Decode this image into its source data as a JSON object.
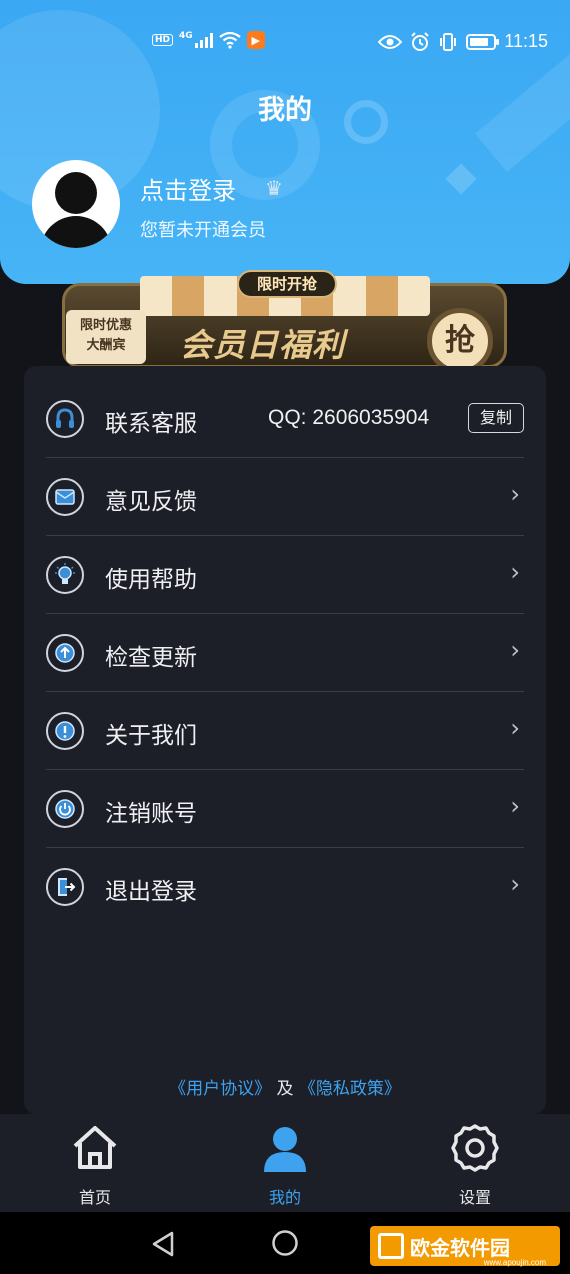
{
  "statusbar": {
    "network_badge": "HD",
    "network_type": "4G",
    "time": "11:15"
  },
  "header": {
    "title": "我的",
    "login_prompt": "点击登录",
    "vip_status": "您暂未开通会员"
  },
  "banner": {
    "tag": "限时开抢",
    "promo_line1": "限时优惠",
    "promo_line2": "大酬宾",
    "headline": "会员日福利",
    "grab_label": "抢"
  },
  "menu": {
    "items": [
      {
        "label": "联系客服",
        "icon": "headset-icon"
      },
      {
        "label": "意见反馈",
        "icon": "feedback-mail-icon"
      },
      {
        "label": "使用帮助",
        "icon": "lightbulb-icon"
      },
      {
        "label": "检查更新",
        "icon": "upload-arrow-icon"
      },
      {
        "label": "关于我们",
        "icon": "info-icon"
      },
      {
        "label": "注销账号",
        "icon": "power-icon"
      },
      {
        "label": "退出登录",
        "icon": "logout-icon"
      }
    ],
    "qq_label": "QQ:  2606035904",
    "copy_label": "复制",
    "chevron": "›"
  },
  "agreement": {
    "user_agreement": "《用户协议》",
    "conjunction": "及",
    "privacy_policy": "《隐私政策》"
  },
  "tabbar": {
    "home": "首页",
    "mine": "我的",
    "settings": "设置"
  },
  "watermark": {
    "text": "欧金软件园",
    "url": "www.apoujin.com"
  },
  "colors": {
    "accent": "#3ea2ee",
    "header_bg": "#3aa8f3",
    "card_bg": "#1c1e28",
    "page_bg": "#121419"
  }
}
